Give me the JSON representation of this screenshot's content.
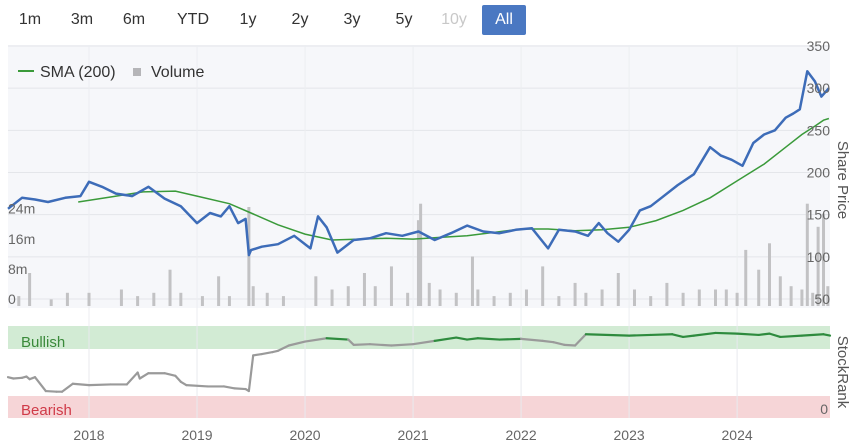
{
  "range_selector": {
    "buttons": [
      {
        "label": "1m",
        "state": "normal"
      },
      {
        "label": "3m",
        "state": "normal"
      },
      {
        "label": "6m",
        "state": "normal"
      },
      {
        "label": "YTD",
        "state": "normal"
      },
      {
        "label": "1y",
        "state": "normal"
      },
      {
        "label": "2y",
        "state": "normal"
      },
      {
        "label": "3y",
        "state": "normal"
      },
      {
        "label": "5y",
        "state": "normal"
      },
      {
        "label": "10y",
        "state": "disabled"
      },
      {
        "label": "All",
        "state": "active"
      }
    ]
  },
  "legend": {
    "sma_label": "SMA (200)",
    "volume_label": "Volume"
  },
  "colors": {
    "price": "#3d6cb8",
    "sma": "#3a9a3a",
    "volume": "#c2c2c4",
    "rank_bull": "#2e8b3e",
    "rank_neutral": "#9a9a9a",
    "bullish_zone": "#d2ebd4",
    "bearish_zone": "#f6d5d7",
    "active_button": "#4a78c2"
  },
  "chart_data": [
    {
      "type": "line",
      "y_axis_title": "Share Price",
      "y_ticks": [
        50,
        100,
        150,
        200,
        250,
        300,
        350
      ],
      "ylim": [
        50,
        350
      ],
      "volume_ticks": [
        "0",
        "8m",
        "16m",
        "24m"
      ],
      "volume_ylim": [
        0,
        40
      ],
      "x_ticks": [
        "2018",
        "2019",
        "2020",
        "2021",
        "2022",
        "2023",
        "2024"
      ],
      "xlim": [
        2017.25,
        2024.86
      ],
      "grid": true,
      "legend_position": "top-left",
      "series": [
        {
          "name": "",
          "x": [
            2017.25,
            2017.38,
            2017.5,
            2017.62,
            2017.78,
            2017.92,
            2018.0,
            2018.12,
            2018.25,
            2018.4,
            2018.55,
            2018.7,
            2018.85,
            2019.0,
            2019.12,
            2019.22,
            2019.3,
            2019.38,
            2019.45,
            2019.48,
            2019.5,
            2019.6,
            2019.75,
            2019.9,
            2020.05,
            2020.12,
            2020.2,
            2020.3,
            2020.45,
            2020.6,
            2020.75,
            2020.9,
            2021.05,
            2021.2,
            2021.35,
            2021.5,
            2021.65,
            2021.8,
            2021.95,
            2022.1,
            2022.25,
            2022.35,
            2022.5,
            2022.62,
            2022.72,
            2022.8,
            2022.9,
            2023.0,
            2023.1,
            2023.2,
            2023.3,
            2023.45,
            2023.6,
            2023.75,
            2023.85,
            2023.95,
            2024.05,
            2024.15,
            2024.25,
            2024.35,
            2024.45,
            2024.52,
            2024.58,
            2024.65,
            2024.72,
            2024.78,
            2024.85
          ],
          "values": [
            157,
            170,
            168,
            165,
            170,
            172,
            189,
            183,
            175,
            172,
            183,
            169,
            160,
            140,
            152,
            148,
            160,
            140,
            145,
            102,
            108,
            112,
            115,
            125,
            110,
            148,
            135,
            105,
            120,
            122,
            128,
            125,
            130,
            120,
            128,
            137,
            130,
            128,
            132,
            134,
            110,
            132,
            130,
            125,
            140,
            128,
            118,
            132,
            155,
            160,
            170,
            185,
            198,
            230,
            220,
            215,
            208,
            235,
            245,
            250,
            265,
            270,
            275,
            320,
            308,
            290,
            300
          ]
        },
        {
          "name": "SMA (200)",
          "x": [
            2017.9,
            2018.2,
            2018.5,
            2018.8,
            2019.0,
            2019.3,
            2019.5,
            2019.75,
            2020.0,
            2020.25,
            2020.5,
            2020.75,
            2021.0,
            2021.25,
            2021.5,
            2021.75,
            2022.0,
            2022.25,
            2022.5,
            2022.75,
            2023.0,
            2023.25,
            2023.5,
            2023.75,
            2024.0,
            2024.25,
            2024.45,
            2024.6,
            2024.72,
            2024.8,
            2024.85
          ],
          "values": [
            165,
            171,
            177,
            178,
            172,
            163,
            152,
            138,
            127,
            120,
            121,
            122,
            121,
            123,
            125,
            129,
            133,
            133,
            131,
            132,
            135,
            143,
            155,
            170,
            190,
            210,
            230,
            245,
            255,
            262,
            264
          ]
        },
        {
          "name": "Volume",
          "x": [
            2017.35,
            2017.45,
            2017.65,
            2017.8,
            2018.0,
            2018.3,
            2018.45,
            2018.6,
            2018.75,
            2018.85,
            2019.05,
            2019.2,
            2019.3,
            2019.48,
            2019.52,
            2019.65,
            2019.8,
            2020.1,
            2020.25,
            2020.4,
            2020.55,
            2020.65,
            2020.8,
            2020.95,
            2021.05,
            2021.07,
            2021.15,
            2021.25,
            2021.4,
            2021.55,
            2021.6,
            2021.75,
            2021.9,
            2022.05,
            2022.2,
            2022.35,
            2022.5,
            2022.6,
            2022.75,
            2022.9,
            2023.05,
            2023.2,
            2023.35,
            2023.5,
            2023.65,
            2023.8,
            2023.9,
            2024.0,
            2024.08,
            2024.2,
            2024.3,
            2024.4,
            2024.5,
            2024.6,
            2024.65,
            2024.7,
            2024.75,
            2024.8,
            2024.84
          ],
          "values": [
            3,
            10,
            2,
            4,
            4,
            5,
            3,
            4,
            11,
            4,
            3,
            9,
            3,
            30,
            6,
            4,
            3,
            9,
            5,
            6,
            10,
            6,
            12,
            4,
            26,
            31,
            7,
            5,
            4,
            15,
            5,
            3,
            4,
            5,
            12,
            3,
            7,
            4,
            5,
            10,
            5,
            3,
            7,
            4,
            5,
            5,
            5,
            4,
            17,
            11,
            19,
            9,
            6,
            5,
            31,
            4,
            24,
            28,
            6
          ]
        }
      ]
    },
    {
      "type": "line",
      "y_axis_title": "StockRank",
      "y_ticks": [
        0
      ],
      "ylim": [
        0,
        100
      ],
      "zone_labels": {
        "bullish": "Bullish",
        "bearish": "Bearish"
      },
      "series": [
        {
          "name": "",
          "x": [
            2017.25,
            2017.3,
            2017.38,
            2017.42,
            2017.45,
            2017.5,
            2017.6,
            2017.7,
            2017.75,
            2017.85,
            2018.0,
            2018.2,
            2018.35,
            2018.45,
            2018.47,
            2018.55,
            2018.7,
            2018.8,
            2018.85,
            2018.9,
            2019.1,
            2019.25,
            2019.35,
            2019.45,
            2019.48,
            2019.52,
            2019.6,
            2019.7,
            2019.75,
            2019.85,
            2020.0,
            2020.2,
            2020.4,
            2020.45,
            2020.6,
            2020.8,
            2021.0,
            2021.2,
            2021.4,
            2021.5,
            2021.6,
            2021.8,
            2022.0,
            2022.2,
            2022.3,
            2022.4,
            2022.5,
            2022.6,
            2023.0,
            2023.2,
            2023.4,
            2023.5,
            2023.6,
            2023.8,
            2024.0,
            2024.2,
            2024.3,
            2024.4,
            2024.6,
            2024.8,
            2024.86
          ],
          "values": [
            27,
            25,
            26,
            28,
            24,
            27,
            6,
            5,
            5,
            17,
            15,
            16,
            16,
            34,
            25,
            33,
            33,
            29,
            20,
            15,
            13,
            13,
            10,
            9,
            6,
            60,
            62,
            65,
            67,
            75,
            81,
            86,
            84,
            76,
            77,
            75,
            77,
            82,
            87,
            84,
            86,
            84,
            85,
            82,
            80,
            76,
            75,
            92,
            90,
            91,
            92,
            88,
            90,
            94,
            93,
            91,
            93,
            88,
            90,
            92,
            90
          ]
        }
      ]
    }
  ]
}
